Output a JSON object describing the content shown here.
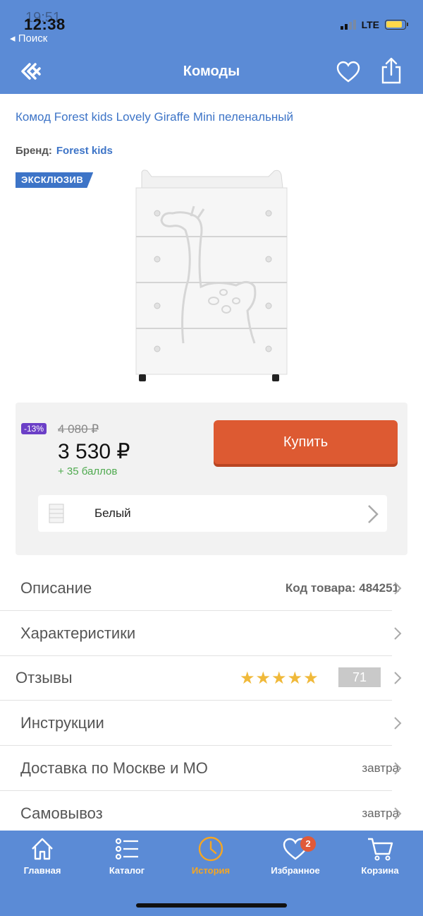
{
  "status_bar": {
    "time": "12:38",
    "time_ghost": "19:51",
    "back_label": "◂ Поиск",
    "network": "LTE"
  },
  "nav": {
    "title": "Комоды",
    "logo_icon": "brand-logo-icon",
    "favorite_icon": "heart-icon",
    "share_icon": "share-icon",
    "header_color": "#5b8bd6"
  },
  "product": {
    "title": "Комод Forest kids Lovely Giraffe Mini пеленальный",
    "brand_label": "Бренд:",
    "brand_name": "Forest kids",
    "badge": "ЭКСКЛЮЗИВ",
    "image_icon": "dresser-giraffe-image"
  },
  "pricing": {
    "discount": "-13%",
    "old_price": "4 080 ₽",
    "price": "3 530 ₽",
    "bonus": "+ 35 баллов",
    "buy_label": "Купить",
    "buy_color": "#dd5a32"
  },
  "variant": {
    "selected_color": "Белый"
  },
  "rows": {
    "description": {
      "label": "Описание",
      "value": "Код товара: 484251"
    },
    "specs": {
      "label": "Характеристики"
    },
    "reviews": {
      "label": "Отзывы",
      "stars": "★★★★★",
      "count": "71",
      "rating": 5
    },
    "instructions": {
      "label": "Инструкции"
    },
    "delivery": {
      "label": "Доставка по Москве и МО",
      "value": "завтра"
    },
    "pickup": {
      "label": "Самовывоз",
      "value": "завтра"
    }
  },
  "tabbar": {
    "home": "Главная",
    "catalog": "Каталог",
    "history": "История",
    "favorites": "Избранное",
    "favorites_count": "2",
    "cart": "Корзина",
    "active_color": "#f5a623"
  }
}
